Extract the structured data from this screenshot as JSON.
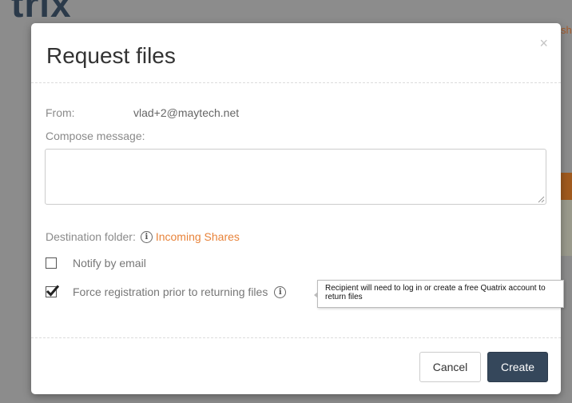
{
  "background": {
    "logo_text": "trix",
    "link_fragment": "sh"
  },
  "modal": {
    "title": "Request files",
    "close_glyph": "×",
    "from_label": "From:",
    "from_value": "vlad+2@maytech.net",
    "compose_label": "Compose message:",
    "message_value": "",
    "destination_label": "Destination folder:",
    "destination_folder": "Incoming Shares",
    "notify_label": "Notify by email",
    "notify_checked": false,
    "force_label": "Force registration prior to returning files",
    "force_checked": true,
    "tooltip": "Recipient will need to log in or create a free Quatrix account to return files",
    "cancel_label": "Cancel",
    "create_label": "Create"
  },
  "icons": {
    "info": "info-icon",
    "check": "checkmark-icon",
    "close": "close-icon"
  },
  "colors": {
    "accent_link": "#e8833a",
    "primary_button": "#35475b"
  }
}
